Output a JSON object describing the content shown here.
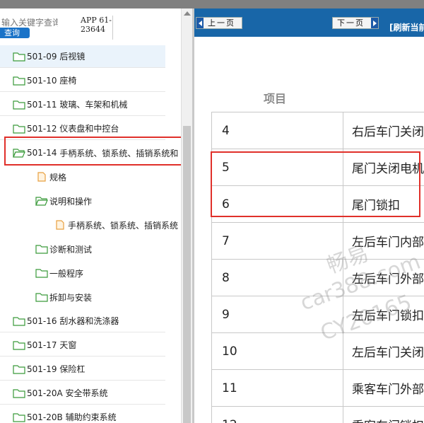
{
  "search": {
    "placeholder": "输入关键字查询",
    "button_label": "查询"
  },
  "app_code": {
    "line1": "APP 61-",
    "line2": "23644"
  },
  "tree": {
    "items": [
      {
        "code": "501-09",
        "label": "后视镜"
      },
      {
        "code": "501-10",
        "label": "座椅"
      },
      {
        "code": "501-11",
        "label": "玻璃、车架和机械"
      },
      {
        "code": "501-12",
        "label": "仪表盘和中控台"
      },
      {
        "code": "501-14",
        "label": "手柄系统、锁系统、插销系统和"
      },
      {
        "label": "规格"
      },
      {
        "label": "说明和操作"
      },
      {
        "label": "手柄系统、锁系统、插销系统"
      },
      {
        "label": "诊断和测试"
      },
      {
        "label": "一般程序"
      },
      {
        "label": "拆卸与安装"
      },
      {
        "code": "501-16",
        "label": "刮水器和洗涤器"
      },
      {
        "code": "501-17",
        "label": "天窗"
      },
      {
        "code": "501-19",
        "label": "保险杠"
      },
      {
        "code": "501-20A",
        "label": "安全带系统"
      },
      {
        "code": "501-20B",
        "label": "辅助约束系统"
      }
    ]
  },
  "toolbar": {
    "prev_label": "上一页",
    "next_label": "下一页",
    "refresh_label": "[刷新当前"
  },
  "doc": {
    "column_header": "项目",
    "rows": [
      {
        "num": "4",
        "item": "右后车门关闭"
      },
      {
        "num": "5",
        "item": "尾门关闭电机"
      },
      {
        "num": "6",
        "item": "尾门锁扣"
      },
      {
        "num": "7",
        "item": "左后车门内部"
      },
      {
        "num": "8",
        "item": "左后车门外部"
      },
      {
        "num": "9",
        "item": "左后车门锁扣"
      },
      {
        "num": "10",
        "item": "左后车门关闭"
      },
      {
        "num": "11",
        "item": "乘客车门外部"
      },
      {
        "num": "12",
        "item": "乘客车门锁扣"
      }
    ],
    "watermark": {
      "line1": "畅易",
      "line2": "car388.com",
      "line3": "CY20165"
    }
  },
  "colors": {
    "toolbar_bg": "#1866a8",
    "highlight_border": "#e0302a",
    "folder_green": "#3a9a3a",
    "file_orange": "#e8a040"
  }
}
